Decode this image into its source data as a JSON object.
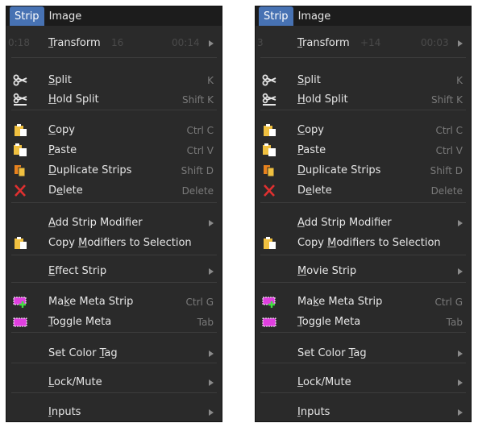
{
  "left": {
    "menubar": {
      "strip": "Strip",
      "image": "Image"
    },
    "bg_timecode": {
      "left": "0:18",
      "mid": "16",
      "right": "00:14"
    },
    "items": [
      {
        "label": "Transform",
        "hotkey": "",
        "icon": "",
        "submenu": true
      },
      {
        "label": "Split",
        "hotkey": "K",
        "icon": "scissors-icon",
        "submenu": false
      },
      {
        "label": "Hold Split",
        "hotkey": "Shift K",
        "icon": "hold-split-icon",
        "submenu": false
      },
      {
        "label": "Copy",
        "hotkey": "Ctrl C",
        "icon": "copy-icon",
        "submenu": false
      },
      {
        "label": "Paste",
        "hotkey": "Ctrl V",
        "icon": "paste-icon",
        "submenu": false
      },
      {
        "label": "Duplicate Strips",
        "hotkey": "Shift D",
        "icon": "duplicate-icon",
        "submenu": false
      },
      {
        "label": "Delete",
        "hotkey": "Delete",
        "icon": "delete-x-icon",
        "submenu": false
      },
      {
        "label": "Add Strip Modifier",
        "hotkey": "",
        "icon": "",
        "submenu": true
      },
      {
        "label": "Copy Modifiers to Selection",
        "hotkey": "",
        "icon": "copy-icon",
        "submenu": false
      },
      {
        "label": "Effect Strip",
        "hotkey": "",
        "icon": "",
        "submenu": true
      },
      {
        "label": "Make Meta Strip",
        "hotkey": "Ctrl G",
        "icon": "make-meta-icon",
        "submenu": false
      },
      {
        "label": "Toggle Meta",
        "hotkey": "Tab",
        "icon": "toggle-meta-icon",
        "submenu": false
      },
      {
        "label": "Set Color Tag",
        "hotkey": "",
        "icon": "",
        "submenu": true
      },
      {
        "label": "Lock/Mute",
        "hotkey": "",
        "icon": "",
        "submenu": true
      },
      {
        "label": "Inputs",
        "hotkey": "",
        "icon": "",
        "submenu": true
      }
    ]
  },
  "right": {
    "menubar": {
      "strip": "Strip",
      "image": "Image"
    },
    "bg_timecode": {
      "left": "3",
      "mid": "+14",
      "right": "00:03"
    },
    "items": [
      {
        "label": "Transform",
        "hotkey": "",
        "icon": "",
        "submenu": true
      },
      {
        "label": "Split",
        "hotkey": "K",
        "icon": "scissors-icon",
        "submenu": false
      },
      {
        "label": "Hold Split",
        "hotkey": "Shift K",
        "icon": "hold-split-icon",
        "submenu": false
      },
      {
        "label": "Copy",
        "hotkey": "Ctrl C",
        "icon": "copy-icon",
        "submenu": false
      },
      {
        "label": "Paste",
        "hotkey": "Ctrl V",
        "icon": "paste-icon",
        "submenu": false
      },
      {
        "label": "Duplicate Strips",
        "hotkey": "Shift D",
        "icon": "duplicate-icon",
        "submenu": false
      },
      {
        "label": "Delete",
        "hotkey": "Delete",
        "icon": "delete-x-icon",
        "submenu": false
      },
      {
        "label": "Add Strip Modifier",
        "hotkey": "",
        "icon": "",
        "submenu": true
      },
      {
        "label": "Copy Modifiers to Selection",
        "hotkey": "",
        "icon": "copy-icon",
        "submenu": false
      },
      {
        "label": "Movie Strip",
        "hotkey": "",
        "icon": "",
        "submenu": true
      },
      {
        "label": "Make Meta Strip",
        "hotkey": "Ctrl G",
        "icon": "make-meta-icon",
        "submenu": false
      },
      {
        "label": "Toggle Meta",
        "hotkey": "Tab",
        "icon": "toggle-meta-icon",
        "submenu": false
      },
      {
        "label": "Set Color Tag",
        "hotkey": "",
        "icon": "",
        "submenu": true
      },
      {
        "label": "Lock/Mute",
        "hotkey": "",
        "icon": "",
        "submenu": true
      },
      {
        "label": "Inputs",
        "hotkey": "",
        "icon": "",
        "submenu": true
      }
    ]
  },
  "colors": {
    "menu_bg": "#2a2a2a",
    "header_active": "#4772b3",
    "text": "#e6e6e6",
    "hotkey": "#7a7a7a",
    "delete_red": "#e03030",
    "clip_yellow": "#f0c040",
    "meta_magenta": "#e040e0"
  }
}
